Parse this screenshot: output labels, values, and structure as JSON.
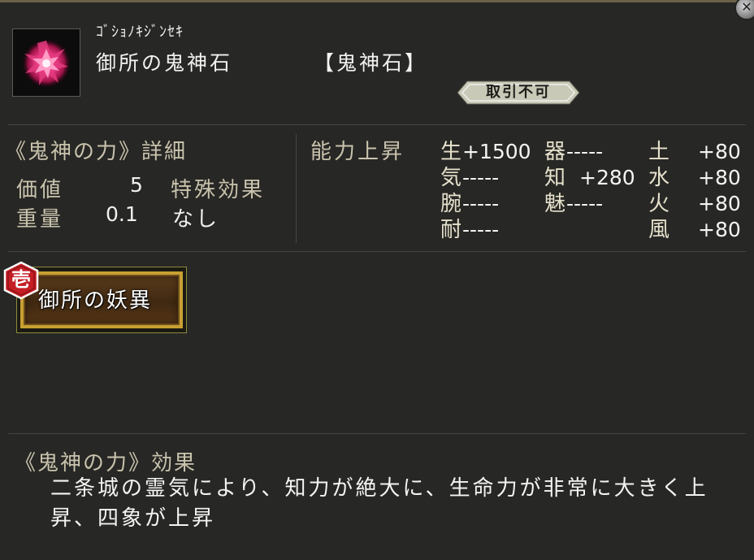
{
  "item": {
    "furigana": "ｺﾞｼｮﾉｷｼﾞﾝｾｷ",
    "name": "御所の鬼神石",
    "type": "【鬼神石】",
    "trade_status": "取引不可"
  },
  "details": {
    "heading": "《鬼神の力》詳細",
    "value_label": "価値",
    "value": "5",
    "weight_label": "重量",
    "weight": "0.1",
    "special_label": "特殊効果",
    "special_value": "なし"
  },
  "ability": {
    "heading": "能力上昇",
    "stats": [
      {
        "label": "生",
        "value": "+1500"
      },
      {
        "label": "気",
        "value": "-----"
      },
      {
        "label": "腕",
        "value": "-----"
      },
      {
        "label": "耐",
        "value": "-----"
      },
      {
        "label": "器",
        "value": "-----"
      },
      {
        "label": "知",
        "value": "+280"
      },
      {
        "label": "魅",
        "value": "-----"
      },
      {
        "label": "土",
        "value": "+80"
      },
      {
        "label": "水",
        "value": "+80"
      },
      {
        "label": "火",
        "value": "+80"
      },
      {
        "label": "風",
        "value": "+80"
      }
    ]
  },
  "skill": {
    "badge": "壱",
    "name": "御所の妖異"
  },
  "effect": {
    "heading": "《鬼神の力》効果",
    "text": "二条城の霊気により、知力が絶大に、生命力が非常に大きく上昇、四象が上昇"
  },
  "colors": {
    "background": "#272725",
    "label": "#c9c3ad",
    "gold_border": "#c8a033",
    "badge_red": "#c41d24"
  },
  "icons": [
    "close-icon",
    "crystal-gem-icon"
  ]
}
